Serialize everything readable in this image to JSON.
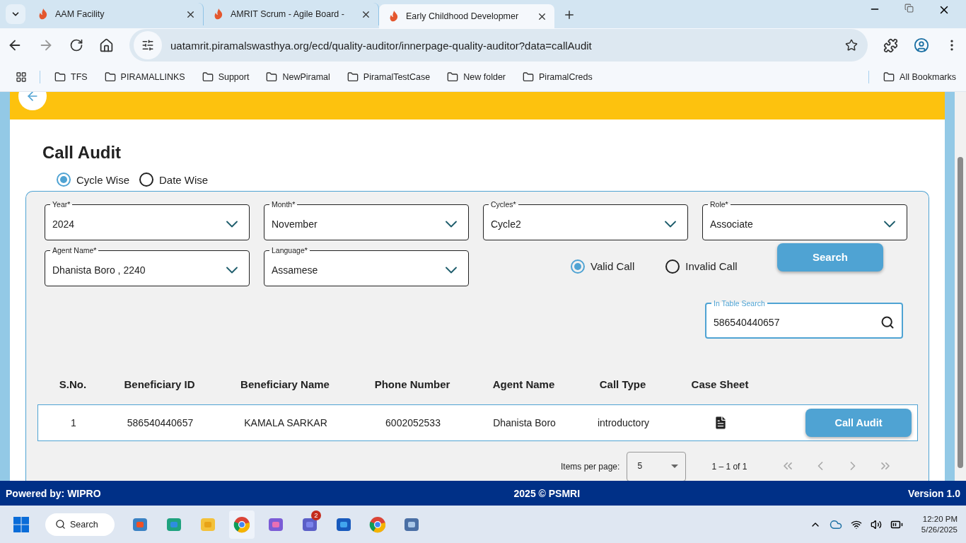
{
  "browser": {
    "tabs": [
      {
        "title": "AAM Facility",
        "selected": false
      },
      {
        "title": "AMRIT Scrum - Agile Board -",
        "selected": false
      },
      {
        "title": "Early Childhood Developmer",
        "selected": true
      }
    ],
    "address": "uatamrit.piramalswasthya.org/ecd/quality-auditor/innerpage-quality-auditor?data=callAudit",
    "bookmarks": [
      "TFS",
      "PIRAMALLINKS",
      "Support",
      "NewPiramal",
      "PiramalTestCase",
      "New folder",
      "PiramalCreds"
    ],
    "all_bookmarks": "All Bookmarks"
  },
  "page": {
    "title": "Call Audit",
    "modes": [
      {
        "label": "Cycle Wise",
        "selected": true
      },
      {
        "label": "Date Wise",
        "selected": false
      }
    ],
    "filters": [
      {
        "label": "Year*",
        "value": "2024"
      },
      {
        "label": "Month*",
        "value": "November"
      },
      {
        "label": "Cycles*",
        "value": "Cycle2"
      },
      {
        "label": "Role*",
        "value": "Associate"
      },
      {
        "label": "Agent Name*",
        "value": "Dhanista Boro , 2240"
      },
      {
        "label": "Language*",
        "value": "Assamese"
      }
    ],
    "call_types": [
      {
        "label": "Valid Call",
        "selected": true
      },
      {
        "label": "Invalid Call",
        "selected": false
      }
    ],
    "search_button": "Search",
    "table_search": {
      "label": "In Table Search",
      "value": "586540440657"
    },
    "table": {
      "columns": [
        "S.No.",
        "Beneficiary ID",
        "Beneficiary Name",
        "Phone Number",
        "Agent Name",
        "Call Type",
        "Case Sheet"
      ],
      "rows": [
        {
          "cells": [
            "1",
            "586540440657",
            "KAMALA SARKAR",
            "6002052533",
            "Dhanista Boro",
            "introductory"
          ],
          "action": "Call Audit"
        }
      ]
    },
    "pagination": {
      "items_label": "Items per page:",
      "page_size": "5",
      "range": "1 – 1 of 1"
    }
  },
  "footer": {
    "left": "Powered by: WIPRO",
    "center": "2025 © PSMRI",
    "right": "Version 1.0"
  },
  "taskbar": {
    "search": "Search",
    "teams_badge": "2",
    "time": "12:20 PM",
    "date": "5/26/2025"
  }
}
